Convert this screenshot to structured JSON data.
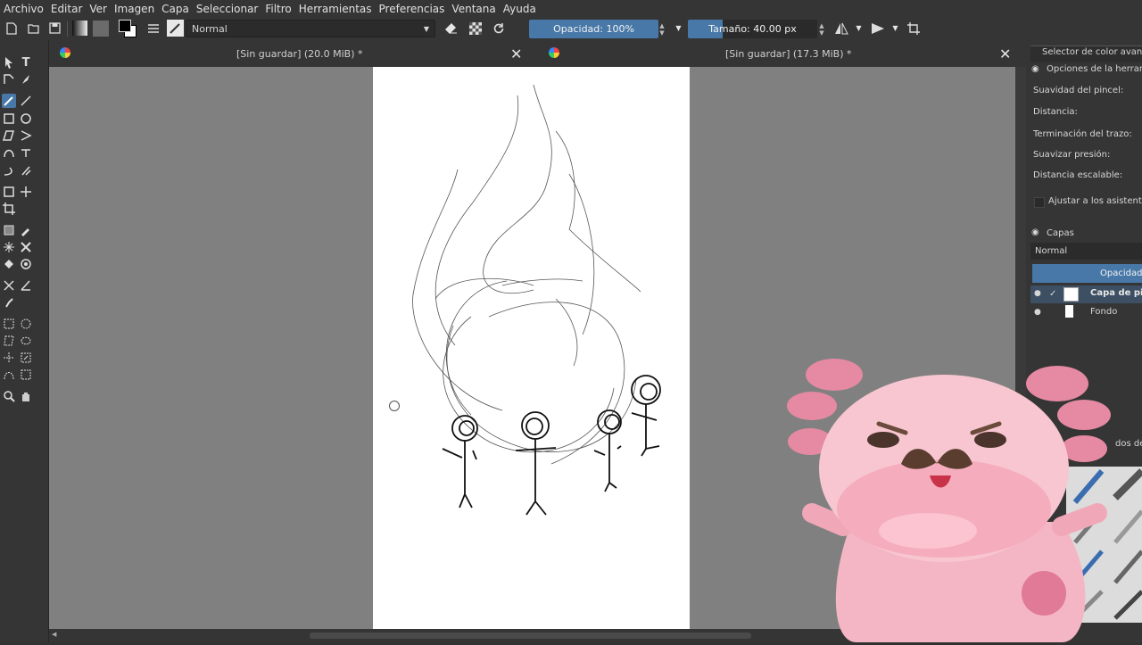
{
  "menu": [
    "Archivo",
    "Editar",
    "Ver",
    "Imagen",
    "Capa",
    "Seleccionar",
    "Filtro",
    "Herramientas",
    "Preferencias",
    "Ventana",
    "Ayuda"
  ],
  "toolbar": {
    "blend_mode": "Normal",
    "opacity_label": "Opacidad: 100%",
    "opacity_value": 1.0,
    "size_label": "Tamaño: 40.00 px",
    "size_value": 40.0,
    "accent_color": "#4778a8"
  },
  "tabs": [
    {
      "title": "[Sin guardar]  (20.0 MiB) *"
    },
    {
      "title": "[Sin guardar]  (17.3 MiB) *"
    }
  ],
  "docker": {
    "color_selector_title": "Selector de color avan...",
    "tool_options_title": "Opciones de la herramie",
    "options": [
      "Suavidad del pincel:",
      "Distancia:",
      "Terminación del trazo:",
      "Suavizar presión:",
      "Distancia escalable:"
    ],
    "snap_label": "Ajustar a los asistentes",
    "layers_title": "Capas",
    "layer_blend": "Normal",
    "layer_opacity": "Opacidad:",
    "layers": [
      "Capa de pin",
      "Fondo"
    ],
    "brush_preset_fragment": "dos de"
  }
}
